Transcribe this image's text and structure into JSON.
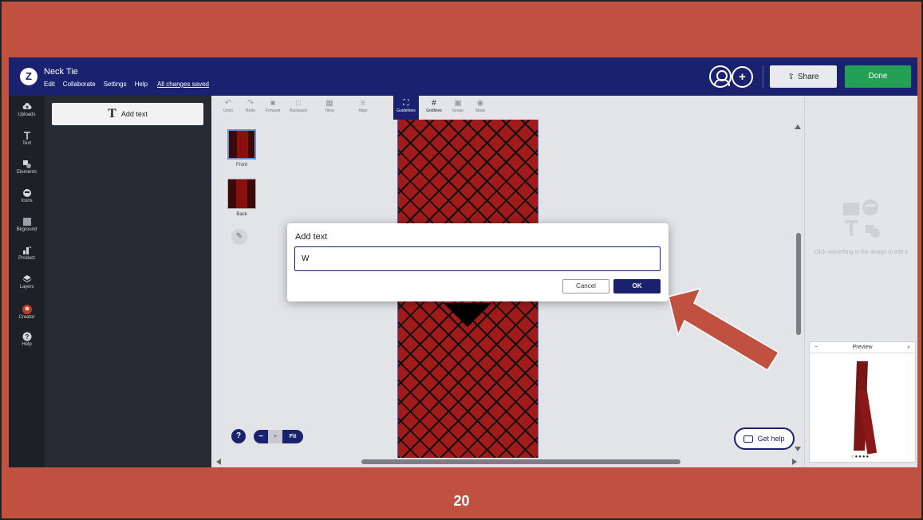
{
  "app": {
    "doc_title": "Neck Tie",
    "menu": [
      "Edit",
      "Collaborate",
      "Settings",
      "Help"
    ],
    "save_status": "All changes saved",
    "share_label": "Share",
    "done_label": "Done",
    "brand_color": "#1a2270",
    "done_color": "#23a055"
  },
  "rail": {
    "items": [
      {
        "label": "Uploads",
        "icon": "cloud-upload-icon"
      },
      {
        "label": "Text",
        "icon": "text-icon"
      },
      {
        "label": "Elements",
        "icon": "shapes-icon"
      },
      {
        "label": "Icons",
        "icon": "emoji-icon"
      },
      {
        "label": "Bkground",
        "icon": "background-icon"
      },
      {
        "label": "Product",
        "icon": "product-icon"
      },
      {
        "label": "Layers",
        "icon": "layers-icon"
      },
      {
        "label": "Creator",
        "icon": "creator-avatar-icon"
      },
      {
        "label": "Help",
        "icon": "help-icon"
      }
    ]
  },
  "panel": {
    "add_text_label": "Add text"
  },
  "toolbar": {
    "tools": [
      {
        "label": "Undo",
        "glyph": "↶",
        "state": "on"
      },
      {
        "label": "Redo",
        "glyph": "↷",
        "state": "off"
      },
      {
        "label": "Forward",
        "glyph": "■",
        "state": "off"
      },
      {
        "label": "Backward",
        "glyph": "□",
        "state": "off"
      },
      {
        "label": "Tiling",
        "glyph": "▦",
        "state": "off"
      },
      {
        "label": "Align",
        "glyph": "≡",
        "state": "off"
      },
      {
        "label": "Guidelines",
        "glyph": "⛶",
        "state": "active"
      },
      {
        "label": "Gridlines",
        "glyph": "#",
        "state": "on"
      },
      {
        "label": "Group",
        "glyph": "▣",
        "state": "off"
      },
      {
        "label": "Mask",
        "glyph": "◉",
        "state": "off"
      }
    ]
  },
  "sides": [
    {
      "label": "Front"
    },
    {
      "label": "Back"
    }
  ],
  "zoom": {
    "minus": "−",
    "plus": "+",
    "fit": "Fit"
  },
  "get_help_label": "Get help",
  "right_panel": {
    "hint": "Click something in the design to edit it."
  },
  "preview": {
    "title": "Preview",
    "dots": "○●●●●"
  },
  "dialog": {
    "title": "Add text",
    "input_value": "W",
    "cancel_label": "Cancel",
    "ok_label": "OK"
  },
  "slide": {
    "page_number": "20",
    "background_color": "#c0503f"
  }
}
